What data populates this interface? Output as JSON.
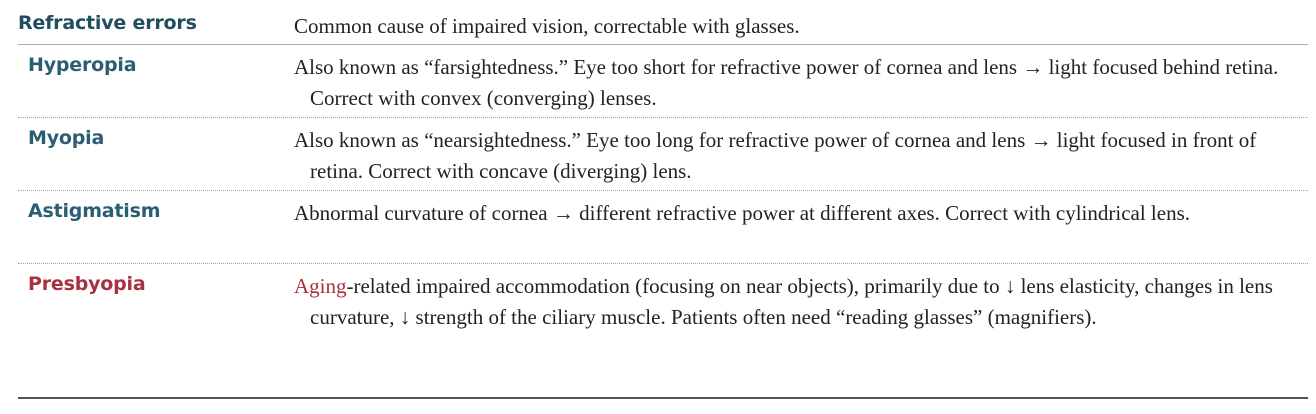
{
  "colors": {
    "heading": "#1f4e5f",
    "term": "#2a5f73",
    "highlight_term": "#a8303f",
    "highlight_word": "#a8303f",
    "body_text": "#222222"
  },
  "header": {
    "term": "Refractive errors",
    "definition": "Common cause of impaired vision, correctable with glasses."
  },
  "rows": [
    {
      "term": "Hyperopia",
      "definition": "Also known as “farsightedness.” Eye too short for refractive power of cornea and lens → light focused behind retina. Correct with convex (converging) lenses."
    },
    {
      "term": "Myopia",
      "definition": "Also known as “nearsightedness.” Eye too long for refractive power of cornea and lens → light focused in front of retina. Correct with concave (diverging) lens."
    },
    {
      "term": "Astigmatism",
      "definition": "Abnormal curvature of cornea → different refractive power at different axes. Correct with cylindrical lens."
    },
    {
      "term": "Presbyopia",
      "definition_highlight": "Aging",
      "definition": "-related impaired accommodation (focusing on near objects), primarily due to ↓ lens elasticity, changes in lens curvature, ↓ strength of the ciliary muscle. Patients often need “reading glasses” (magnifiers)."
    }
  ]
}
